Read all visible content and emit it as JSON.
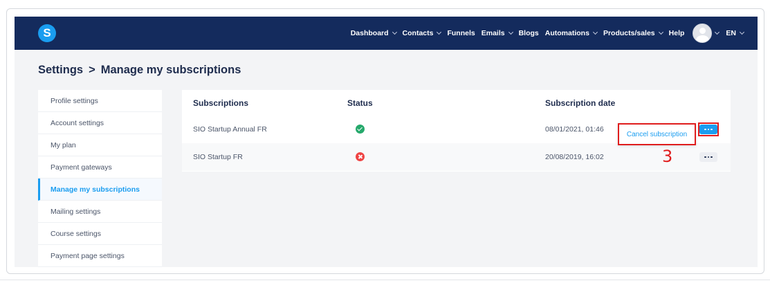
{
  "nav": {
    "logo_letter": "S",
    "items": [
      {
        "label": "Dashboard",
        "dropdown": true
      },
      {
        "label": "Contacts",
        "dropdown": true
      },
      {
        "label": "Funnels",
        "dropdown": false
      },
      {
        "label": "Emails",
        "dropdown": true
      },
      {
        "label": "Blogs",
        "dropdown": false
      },
      {
        "label": "Automations",
        "dropdown": true
      },
      {
        "label": "Products/sales",
        "dropdown": true
      },
      {
        "label": "Help",
        "dropdown": false
      }
    ],
    "language": "EN"
  },
  "page": {
    "breadcrumb_root": "Settings",
    "breadcrumb_sep": ">",
    "breadcrumb_current": "Manage my subscriptions"
  },
  "sidebar": {
    "items": [
      {
        "label": "Profile settings",
        "active": false
      },
      {
        "label": "Account settings",
        "active": false
      },
      {
        "label": "My plan",
        "active": false
      },
      {
        "label": "Payment gateways",
        "active": false
      },
      {
        "label": "Manage my subscriptions",
        "active": true
      },
      {
        "label": "Mailing settings",
        "active": false
      },
      {
        "label": "Course settings",
        "active": false
      },
      {
        "label": "Payment page settings",
        "active": false
      }
    ]
  },
  "table": {
    "headers": {
      "subscriptions": "Subscriptions",
      "status": "Status",
      "date": "Subscription date"
    },
    "rows": [
      {
        "name": "SIO Startup Annual FR",
        "status": "active",
        "date": "08/01/2021, 01:46"
      },
      {
        "name": "SIO Startup FR",
        "status": "cancelled",
        "date": "20/08/2019, 16:02"
      }
    ],
    "menu_action": "Cancel subscription"
  },
  "annotation": {
    "step": "3"
  },
  "colors": {
    "navbar": "#142b5d",
    "accent": "#1a9df0",
    "success": "#26a96c",
    "error": "#ef4444",
    "annotation": "#e01d1d"
  }
}
